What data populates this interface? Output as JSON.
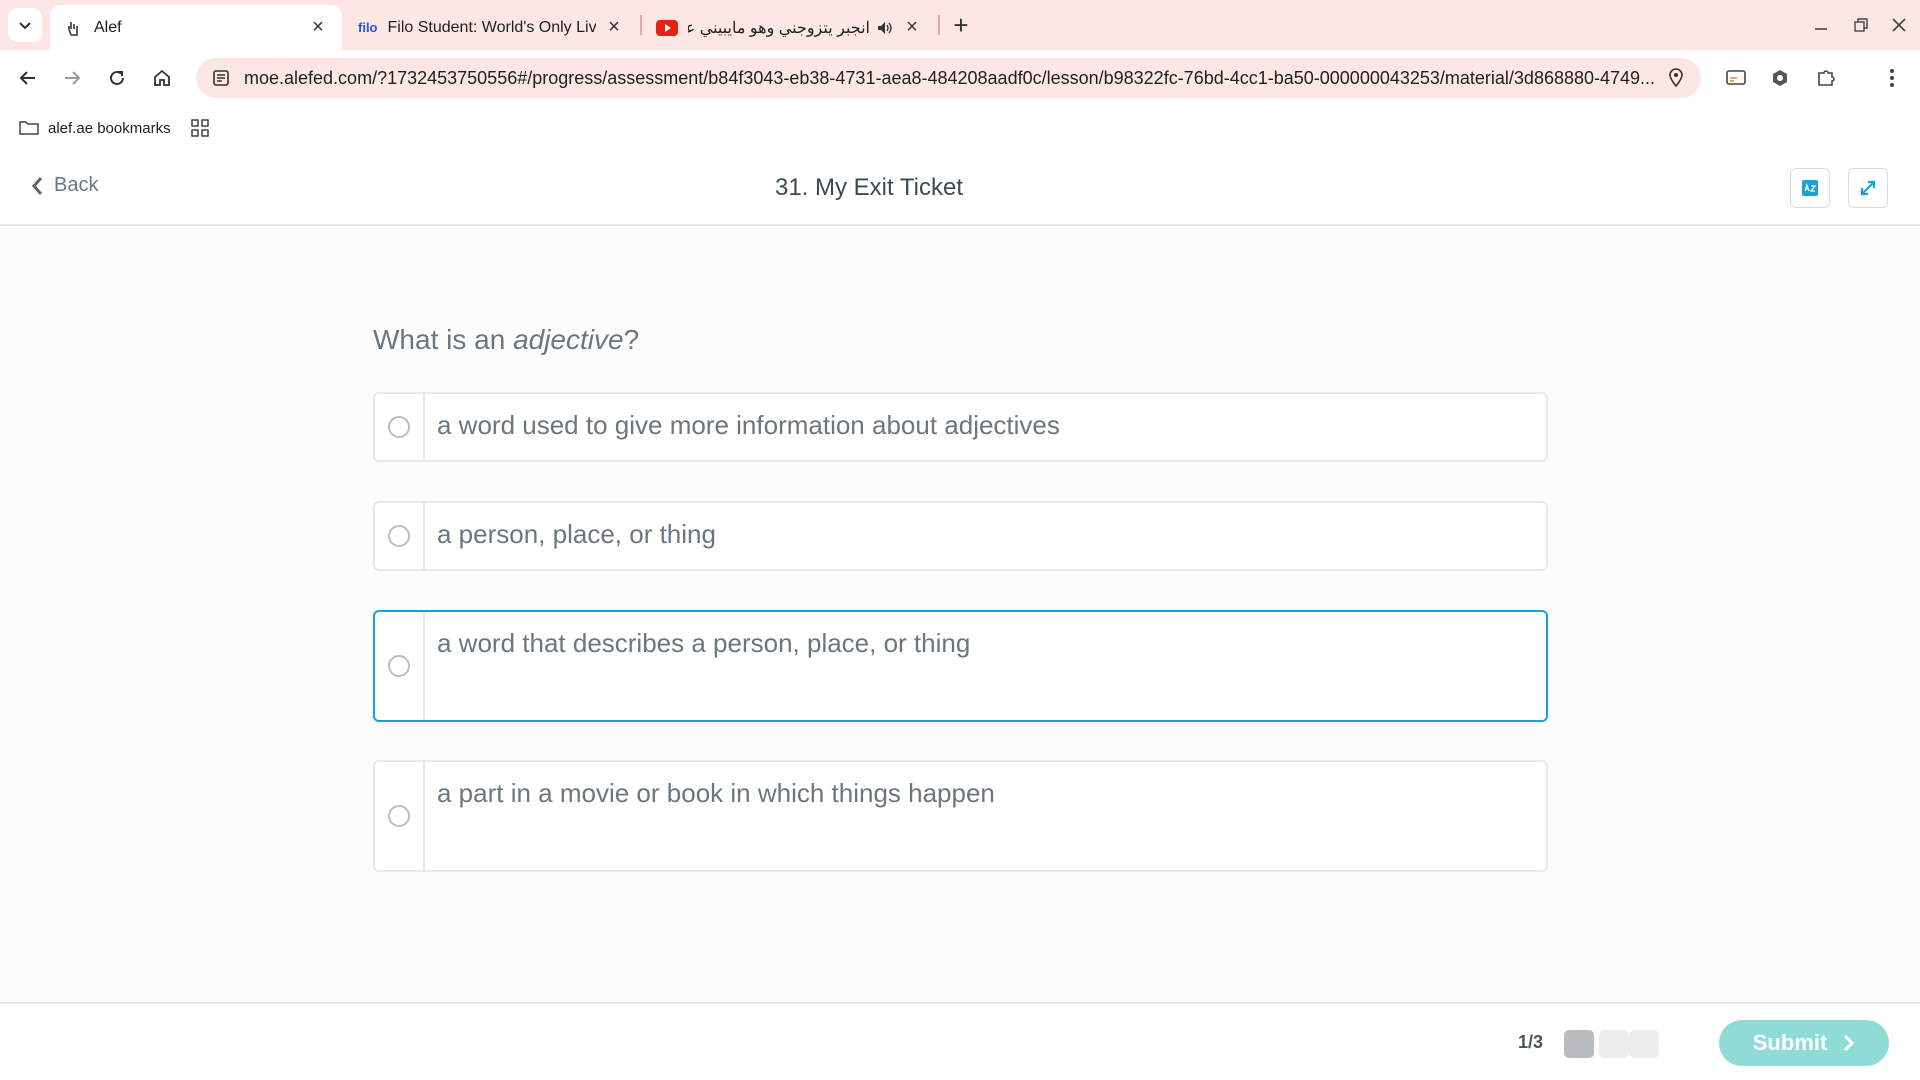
{
  "browser": {
    "tabs": [
      {
        "title": "Alef",
        "active": true,
        "icon": "hand-icon"
      },
      {
        "title": "Filo Student: World's Only Live",
        "active": false,
        "icon": "filo-icon",
        "favicon_text": "filo"
      },
      {
        "title": "انجبر يتزوجني وهو مايبيني عشا",
        "active": false,
        "icon": "youtube-icon"
      }
    ],
    "url": "moe.alefed.com/?1732453750556#/progress/assessment/b84f3043-eb38-4731-aea8-484208aadf0c/lesson/b98322fc-76bd-4cc1-ba50-000000043253/material/3d868880-4749...",
    "bookmarks_label": "alef.ae bookmarks"
  },
  "header": {
    "back_label": "Back",
    "title": "31. My Exit Ticket"
  },
  "question": {
    "prefix": "What is an ",
    "emphasis": "adjective",
    "suffix": "?"
  },
  "options": [
    {
      "text": "a word used to give more information about adjectives",
      "selected": false
    },
    {
      "text": "a person, place, or thing",
      "selected": false
    },
    {
      "text": "a word that describes a person, place, or thing",
      "selected": true
    },
    {
      "text": "a part in a movie or book in which things happen",
      "selected": false
    }
  ],
  "footer": {
    "pager": "1/3",
    "submit_label": "Submit"
  },
  "colors": {
    "accent": "#1aa1d9",
    "submit": "#8fdcd7",
    "chrome": "#fde7e5"
  }
}
